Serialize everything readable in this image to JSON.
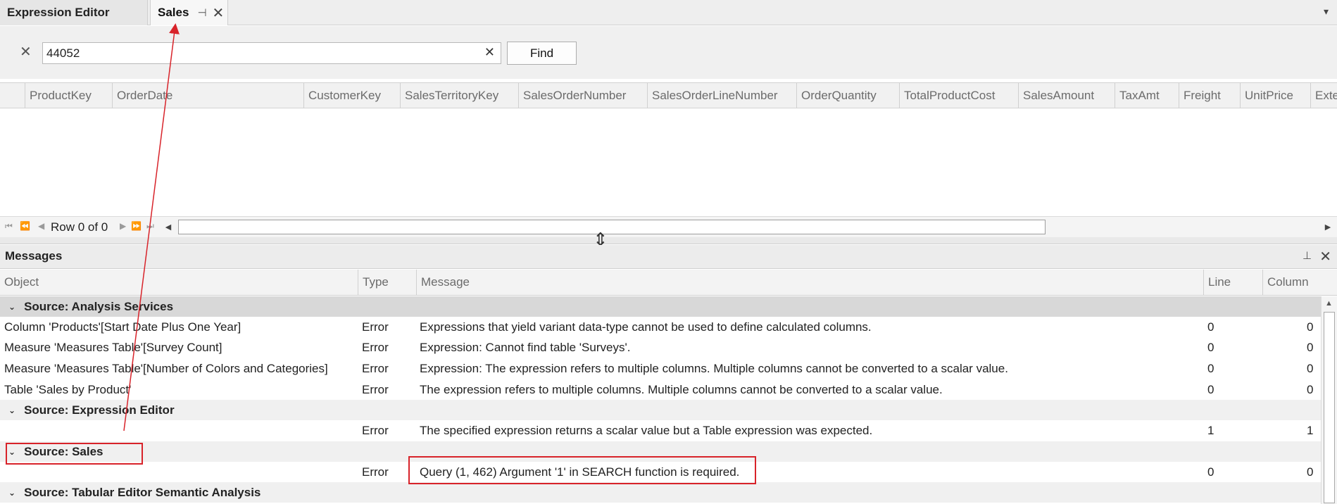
{
  "tabs": {
    "expression_editor": "Expression Editor",
    "sales": "Sales",
    "pin_glyph": "⊣",
    "close_glyph": "✕",
    "menu_glyph": "▾"
  },
  "search": {
    "clear_glyph": "✕",
    "value": "44052",
    "input_clear_glyph": "✕",
    "find_label": "Find"
  },
  "grid": {
    "columns": [
      "ProductKey",
      "OrderDate",
      "CustomerKey",
      "SalesTerritoryKey",
      "SalesOrderNumber",
      "SalesOrderLineNumber",
      "OrderQuantity",
      "TotalProductCost",
      "SalesAmount",
      "TaxAmt",
      "Freight",
      "UnitPrice",
      "Exte"
    ],
    "nav": {
      "first": "⏮",
      "prev_page": "⏪",
      "prev": "◀",
      "next": "▶",
      "next_page": "⏩",
      "last": "⏭"
    },
    "row_status": "Row 0 of 0",
    "scroll_left": "◀",
    "scroll_right": "▶"
  },
  "splitter_glyph": "⇕",
  "messages": {
    "title": "Messages",
    "pin_glyph": "⊥",
    "close_glyph": "✕",
    "columns": [
      "Object",
      "Type",
      "Message",
      "Line",
      "Column"
    ],
    "chevron": "⌄",
    "scroll_up": "▲",
    "groups": {
      "analysis_services": "Source: Analysis Services",
      "expression_editor": "Source: Expression Editor",
      "sales": "Source: Sales",
      "semantic": "Source: Tabular Editor Semantic Analysis"
    },
    "rows": [
      {
        "object": "Column 'Products'[Start Date Plus One Year]",
        "type": "Error",
        "message": "Expressions that yield variant data-type cannot be used to define calculated columns.",
        "line": "0",
        "column": "0"
      },
      {
        "object": "Measure 'Measures Table'[Survey Count]",
        "type": "Error",
        "message": "Expression: Cannot find table 'Surveys'.",
        "line": "0",
        "column": "0"
      },
      {
        "object": "Measure 'Measures Table'[Number of Colors and Categories]",
        "type": "Error",
        "message": "Expression: The expression refers to multiple columns. Multiple columns cannot be converted to a scalar value.",
        "line": "0",
        "column": "0"
      },
      {
        "object": "Table 'Sales by Product'",
        "type": "Error",
        "message": "The expression refers to multiple columns. Multiple columns cannot be converted to a scalar value.",
        "line": "0",
        "column": "0"
      },
      {
        "object": "",
        "type": "Error",
        "message": "The specified expression returns a scalar value but a Table expression was expected.",
        "line": "1",
        "column": "1"
      },
      {
        "object": "",
        "type": "Error",
        "message": "Query (1, 462) Argument '1' in SEARCH function is required.",
        "line": "0",
        "column": "0"
      }
    ]
  },
  "annotation_color": "#d8232a"
}
